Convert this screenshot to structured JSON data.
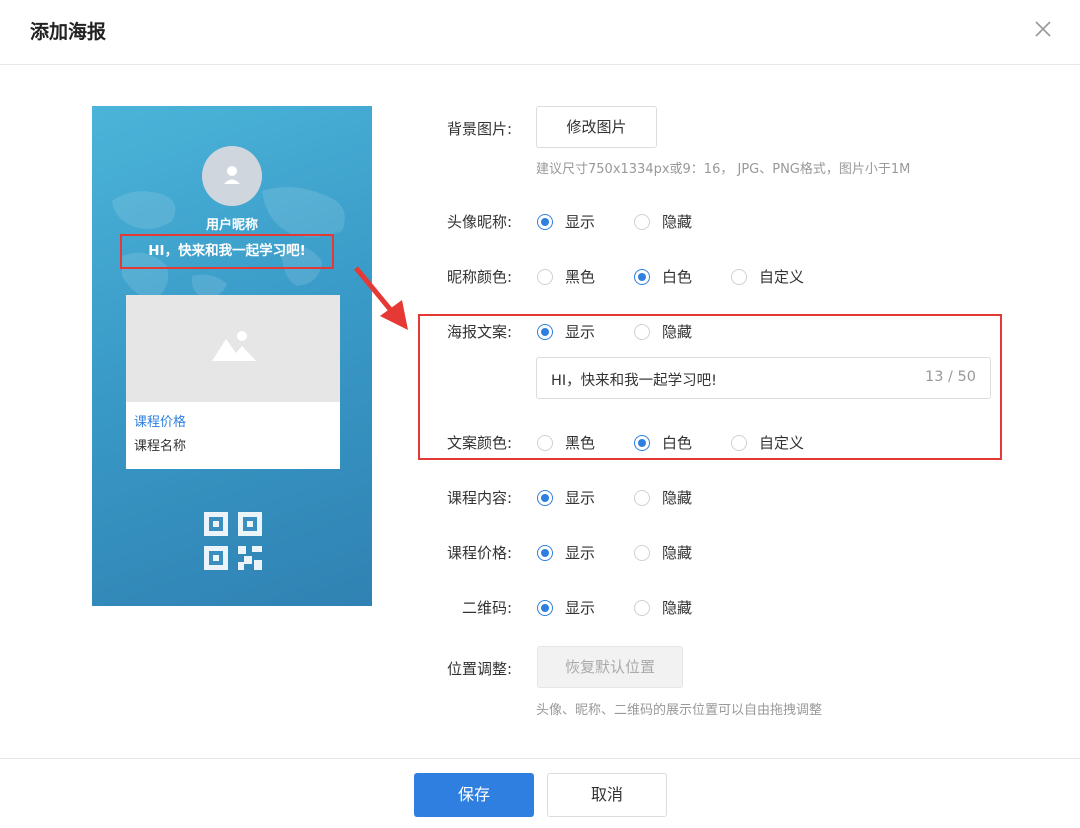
{
  "dialog": {
    "title": "添加海报"
  },
  "poster": {
    "nickname": "用户昵称",
    "text": "HI，快来和我一起学习吧!",
    "course_price": "课程价格",
    "course_name": "课程名称"
  },
  "form": {
    "background": {
      "label": "背景图片:",
      "button": "修改图片",
      "hint": "建议尺寸750x1334px或9：16， JPG、PNG格式，图片小于1M"
    },
    "avatar_nickname": {
      "label": "头像昵称:",
      "options": [
        "显示",
        "隐藏"
      ],
      "selected": "显示"
    },
    "nickname_color": {
      "label": "昵称颜色:",
      "options": [
        "黑色",
        "白色",
        "自定义"
      ],
      "selected": "白色"
    },
    "poster_text": {
      "label": "海报文案:",
      "options": [
        "显示",
        "隐藏"
      ],
      "selected": "显示",
      "input_value": "HI，快来和我一起学习吧!",
      "counter": "13 / 50"
    },
    "text_color": {
      "label": "文案颜色:",
      "options": [
        "黑色",
        "白色",
        "自定义"
      ],
      "selected": "白色"
    },
    "course_content": {
      "label": "课程内容:",
      "options": [
        "显示",
        "隐藏"
      ],
      "selected": "显示"
    },
    "course_price": {
      "label": "课程价格:",
      "options": [
        "显示",
        "隐藏"
      ],
      "selected": "显示"
    },
    "qrcode": {
      "label": "二维码:",
      "options": [
        "显示",
        "隐藏"
      ],
      "selected": "显示"
    },
    "position": {
      "label": "位置调整:",
      "button": "恢复默认位置",
      "hint": "头像、昵称、二维码的展示位置可以自由拖拽调整"
    }
  },
  "footer": {
    "save": "保存",
    "cancel": "取消"
  },
  "colors": {
    "accent": "#2f7fe0",
    "highlight": "#e53935",
    "poster_bg": "#3a9bc8"
  },
  "icons": [
    "close-icon",
    "user-icon",
    "image-icon",
    "qrcode-icon",
    "arrow-icon"
  ]
}
